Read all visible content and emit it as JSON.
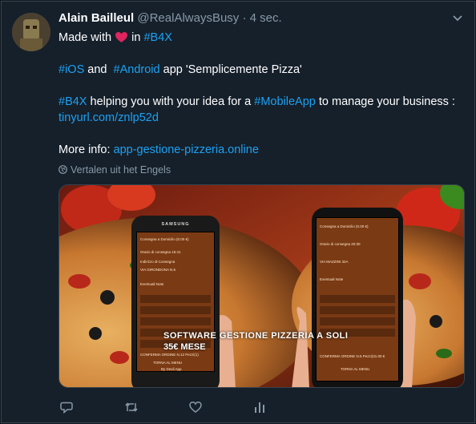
{
  "tweet": {
    "author_name": "Alain Bailleul",
    "author_handle": "@RealAlwaysBusy",
    "separator": " · ",
    "time": "4 sec.",
    "line1_prefix": "Made with",
    "line1_in": "in",
    "hashtag_b4x": "#B4X",
    "hashtag_ios": "#iOS",
    "and_text": "and",
    "hashtag_android": "#Android",
    "app_text": "app 'Semplicemente Pizza'",
    "hashtag_b4x_2": "#B4X",
    "helping_text": "helping you with your idea for a",
    "hashtag_mobileapp": "#MobileApp",
    "manage_text": "to manage your business :",
    "short_link": "tinyurl.com/znlp52d",
    "more_info_label": "More info:",
    "more_info_link": "app-gestione-pizzeria.online",
    "translate_label": "Vertalen uit het Engels"
  },
  "media": {
    "caption_line1": "SOFTWARE GESTIONE PIZZERIA A SOLI",
    "caption_line2": "35€ MESE",
    "phone_brand": "SAMSUNG",
    "left_phone": {
      "header": "Consegna a Domicilio (0.00 €)",
      "time": "Orario di consegna 16:41",
      "address_label": "Indirizzo di Consegna",
      "address": "VIA GIRONDONA N.5",
      "notes": "Eventuali Note",
      "footer": "CONFERMA ORDINE N.12 Pezzi(1)",
      "footer2": "TORNA AL MENU",
      "byline": "By Devil App"
    },
    "right_phone": {
      "header": "Consegna a Domicilio (0.00 €)",
      "time": "Orario di consegna 20:30",
      "address": "VIA MAZZINI 32A",
      "notes": "Eventuali Note",
      "footer": "CONFERMA ORDINE N.5 Pezzi(31.00 €",
      "footer2": "TORNA AL MENU"
    }
  },
  "colors": {
    "background": "#15202b",
    "link": "#1da1f2",
    "muted": "#8899a6",
    "heart": "#e0245e"
  },
  "icons": [
    "chevron-down-icon",
    "heart-icon",
    "globe-icon",
    "reply-icon",
    "retweet-icon",
    "like-icon",
    "analytics-icon"
  ]
}
